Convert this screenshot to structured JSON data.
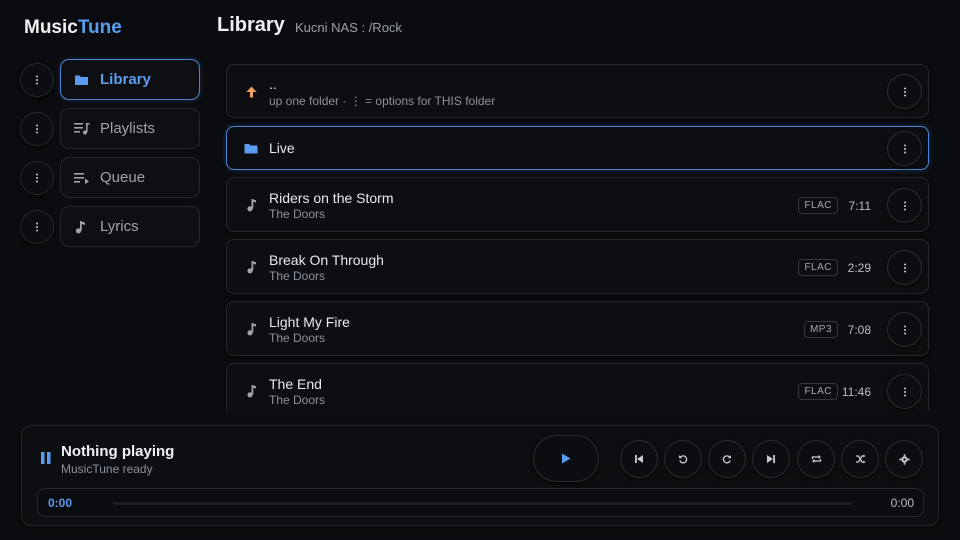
{
  "app": {
    "name_part1": "Music",
    "name_part2": "Tune"
  },
  "sidebar": {
    "items": [
      {
        "label": "Library",
        "icon": "folder-icon",
        "active": true
      },
      {
        "label": "Playlists",
        "icon": "playlist-icon",
        "active": false
      },
      {
        "label": "Queue",
        "icon": "queue-icon",
        "active": false
      },
      {
        "label": "Lyrics",
        "icon": "music-note-icon",
        "active": false
      }
    ]
  },
  "header": {
    "title": "Library",
    "path": "Kucni NAS : /Rock"
  },
  "list": {
    "up": {
      "title": "..",
      "hint": "up one folder · ⋮ = options for THIS folder"
    },
    "folders": [
      {
        "name": "Live"
      }
    ],
    "tracks": [
      {
        "title": "Riders on the Storm",
        "artist": "The Doors",
        "format": "FLAC",
        "duration": "7:11"
      },
      {
        "title": "Break On Through",
        "artist": "The Doors",
        "format": "FLAC",
        "duration": "2:29"
      },
      {
        "title": "Light My Fire",
        "artist": "The Doors",
        "format": "MP3",
        "duration": "7:08"
      },
      {
        "title": "The End",
        "artist": "The Doors",
        "format": "FLAC",
        "duration": "11:46"
      }
    ]
  },
  "player": {
    "title": "Nothing playing",
    "subtitle": "MusicTune ready",
    "current_time": "0:00",
    "total_time": "0:00",
    "progress": 0,
    "controls": [
      "previous-icon",
      "rewind-icon",
      "forward-icon",
      "next-icon",
      "repeat-icon",
      "shuffle-icon",
      "settings-icon"
    ]
  },
  "colors": {
    "accent": "#5b9cf0",
    "up_arrow": "#f0a060",
    "background": "#0b0c0f"
  }
}
